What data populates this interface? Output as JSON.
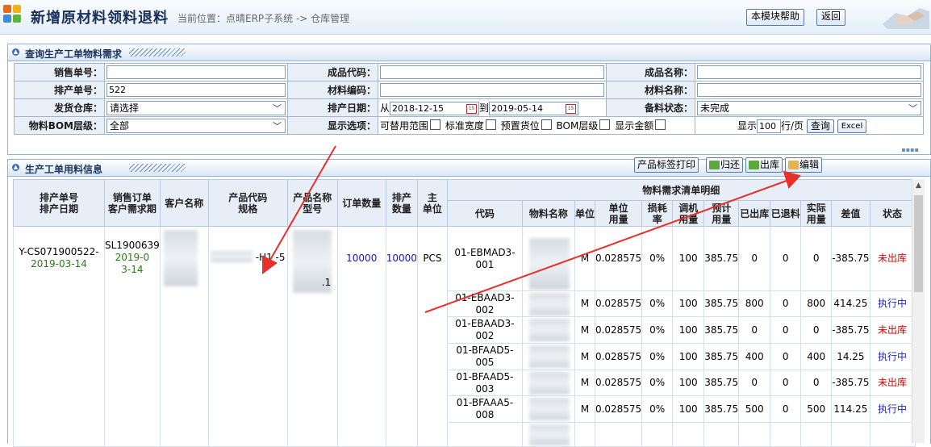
{
  "header": {
    "title": "新增原材料领料退料",
    "breadcrumb": "当前位置：点晴ERP子系统 -> 仓库管理",
    "help_button": "本模块帮助",
    "back_button": "返回"
  },
  "query_panel": {
    "title": "查询生产工单物料需求",
    "labels": {
      "sales_no": "销售单号：",
      "product_code": "成品代码：",
      "product_name": "成品名称：",
      "schedule_no": "排产单号：",
      "material_code": "材料编码：",
      "material_name": "材料名称：",
      "ship_warehouse": "发货仓库：",
      "schedule_date": "排产日期：",
      "prep_status": "备料状态：",
      "bom_level": "物料BOM层级：",
      "display_options": "显示选项："
    },
    "values": {
      "sales_no": "",
      "product_code": "",
      "product_name": "",
      "schedule_no": "522",
      "material_code": "",
      "material_name": "",
      "ship_warehouse": "请选择",
      "date_from_label": "从",
      "date_from": "2018-12-15",
      "date_to_label": "到",
      "date_to": "2019-05-14",
      "prep_status": "未完成",
      "bom_level": "全部"
    },
    "options": [
      "可替用范围",
      "标准宽度",
      "预置货位",
      "BOM层级",
      "显示金额"
    ],
    "show_label": "显示",
    "page_size": "100",
    "per_page": "行/页",
    "query_button": "查询",
    "excel_button": "Excel"
  },
  "grid_panel": {
    "title": "生产工单用料信息",
    "buttons": {
      "print": "产品标签打印",
      "return": "归还",
      "outbound": "出库",
      "edit": "编辑"
    },
    "headers": {
      "schedule": [
        "排产单号",
        "排产日期"
      ],
      "sales": [
        "销售订单",
        "客户需求期"
      ],
      "customer": "客户名称",
      "product_code": [
        "产品代码",
        "规格"
      ],
      "product_name": [
        "产品名称",
        "型号"
      ],
      "order_qty": "订单数量",
      "sched_qty": [
        "排产",
        "数量"
      ],
      "main_unit": [
        "主",
        "单位"
      ],
      "detail_group": "物料需求清单明细",
      "code": "代码",
      "mat_name": "物料名称",
      "unit": "单位",
      "unit_usage": [
        "单位",
        "用量"
      ],
      "loss_rate": [
        "损耗",
        "率"
      ],
      "adjust": [
        "调机",
        "用量"
      ],
      "plan": [
        "预计",
        "用量"
      ],
      "out": "已出库",
      "returned": "已退料",
      "actual": [
        "实际",
        "用量"
      ],
      "diff": "差值",
      "status": "状态"
    },
    "order": {
      "schedule_no": "Y-CS071900522-",
      "schedule_date": "2019-03-14",
      "sales_no": "SL1900639",
      "sales_date": "2019-03-14",
      "product_code_fragment": "-H1  -5",
      "product_name_fragment": ".1",
      "order_qty": "10000",
      "sched_qty": "10000",
      "unit": "PCS"
    },
    "rows": [
      {
        "code": "01-EBMAD3-001",
        "unit": "M",
        "unit_usage": "0.028575",
        "loss": "0%",
        "adjust": "100",
        "plan": "385.75",
        "out": "0",
        "returned": "0",
        "actual": "0",
        "diff": "-385.75",
        "status": "未出库"
      },
      {
        "code": "01-EBAAD3-002",
        "unit": "M",
        "unit_usage": "0.028575",
        "loss": "0%",
        "adjust": "100",
        "plan": "385.75",
        "out": "800",
        "returned": "0",
        "actual": "800",
        "diff": "414.25",
        "status": "执行中"
      },
      {
        "code": "01-EBAAD3-002",
        "unit": "M",
        "unit_usage": "0.028575",
        "loss": "0%",
        "adjust": "100",
        "plan": "385.75",
        "out": "0",
        "returned": "0",
        "actual": "0",
        "diff": "-385.75",
        "status": "未出库"
      },
      {
        "code": "01-BFAAD5-005",
        "unit": "M",
        "unit_usage": "0.028575",
        "loss": "0%",
        "adjust": "100",
        "plan": "385.75",
        "out": "400",
        "returned": "0",
        "actual": "400",
        "diff": "14.25",
        "status": "执行中"
      },
      {
        "code": "01-BFAAD5-003",
        "unit": "M",
        "unit_usage": "0.028575",
        "loss": "0%",
        "adjust": "100",
        "plan": "385.75",
        "out": "0",
        "returned": "0",
        "actual": "0",
        "diff": "-385.75",
        "status": "未出库"
      },
      {
        "code": "01-BFAAA5-008",
        "unit": "M",
        "unit_usage": "0.028575",
        "loss": "0%",
        "adjust": "100",
        "plan": "385.75",
        "out": "500",
        "returned": "0",
        "actual": "500",
        "diff": "114.25",
        "status": "执行中"
      }
    ]
  },
  "colors": {
    "accent": "#1b355f",
    "not_out": "#e00000",
    "executing": "#2323c8",
    "date_green": "#2a7a1a",
    "annotation_arrow": "#e8302a"
  }
}
